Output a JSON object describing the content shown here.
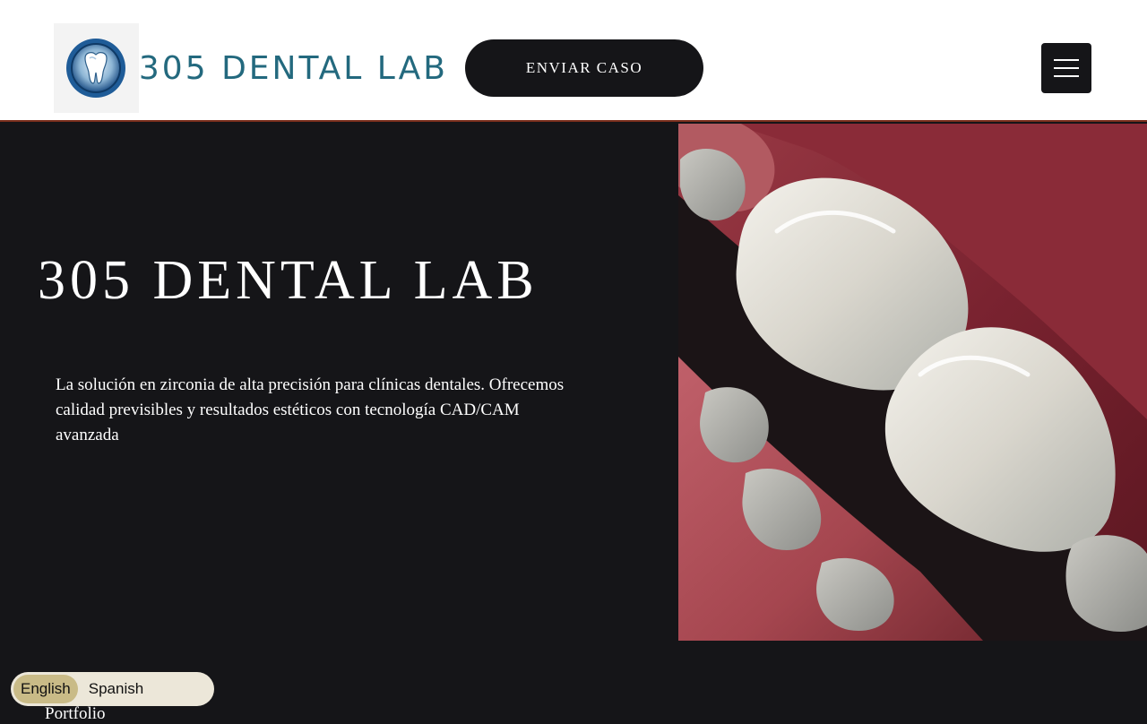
{
  "header": {
    "logo_text": "305 DENTAL LAB",
    "logo_icon": "tooth-logo-icon",
    "cta_label": "ENVIAR CASO",
    "menu_icon": "hamburger-menu-icon"
  },
  "hero": {
    "title": "305 DENTAL LAB",
    "description": "La solución en zirconia de alta precisión para clínicas dentales. Ofrecemos calidad previsibles y resultados estéticos con tecnología CAD/CAM avanzada",
    "image_subject": "teeth-closeup-image"
  },
  "language_switch": {
    "options": [
      "English",
      "Spanish"
    ],
    "selected": "English"
  },
  "nav": {
    "portfolio_label": "Portfolio"
  },
  "colors": {
    "brand_teal": "#23697e",
    "dark_bg": "#151518",
    "accent_border": "#7a2e1c",
    "lang_active": "#c9bb87",
    "lang_bg": "#ece7d9"
  }
}
